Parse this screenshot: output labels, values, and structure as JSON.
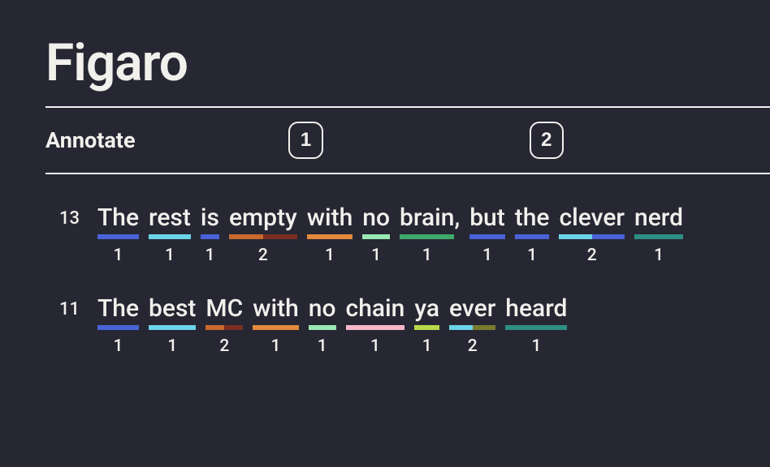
{
  "title": "Figaro",
  "nav": {
    "label": "Annotate",
    "buttons": [
      "1",
      "2"
    ]
  },
  "colors": {
    "blue": "#4a62d8",
    "cyan": "#6cd4e8",
    "darkorange": "#c96a2e",
    "maroon": "#7a2f22",
    "orange": "#e38a3d",
    "mint": "#9ae8b3",
    "green": "#3fa86b",
    "pink": "#f5b8c8",
    "teal": "#2f8f84",
    "lime": "#b8d94a",
    "olive": "#7a7a2e"
  },
  "lines": [
    {
      "num": "13",
      "words": [
        {
          "text": "The",
          "syl": "1",
          "colors": [
            "blue"
          ]
        },
        {
          "text": "rest",
          "syl": "1",
          "colors": [
            "cyan"
          ]
        },
        {
          "text": "is",
          "syl": "1",
          "colors": [
            "blue"
          ]
        },
        {
          "text": "empty",
          "syl": "2",
          "colors": [
            "darkorange",
            "maroon"
          ]
        },
        {
          "text": "with",
          "syl": "1",
          "colors": [
            "orange"
          ]
        },
        {
          "text": "no",
          "syl": "1",
          "colors": [
            "mint"
          ]
        },
        {
          "text": "brain",
          "syl": "1",
          "colors": [
            "green"
          ],
          "after": ","
        },
        {
          "text": "but",
          "syl": "1",
          "colors": [
            "blue"
          ]
        },
        {
          "text": "the",
          "syl": "1",
          "colors": [
            "blue"
          ]
        },
        {
          "text": "clever",
          "syl": "2",
          "colors": [
            "cyan",
            "blue"
          ]
        },
        {
          "text": "nerd",
          "syl": "1",
          "colors": [
            "teal"
          ]
        }
      ]
    },
    {
      "num": "11",
      "words": [
        {
          "text": "The",
          "syl": "1",
          "colors": [
            "blue"
          ]
        },
        {
          "text": "best",
          "syl": "1",
          "colors": [
            "cyan"
          ]
        },
        {
          "text": "MC",
          "syl": "2",
          "colors": [
            "darkorange",
            "maroon"
          ]
        },
        {
          "text": "with",
          "syl": "1",
          "colors": [
            "orange"
          ]
        },
        {
          "text": "no",
          "syl": "1",
          "colors": [
            "mint"
          ]
        },
        {
          "text": "chain",
          "syl": "1",
          "colors": [
            "pink"
          ]
        },
        {
          "text": "ya",
          "syl": "1",
          "colors": [
            "lime"
          ]
        },
        {
          "text": "ever",
          "syl": "2",
          "colors": [
            "cyan",
            "olive"
          ]
        },
        {
          "text": "heard",
          "syl": "1",
          "colors": [
            "teal"
          ]
        }
      ]
    }
  ]
}
